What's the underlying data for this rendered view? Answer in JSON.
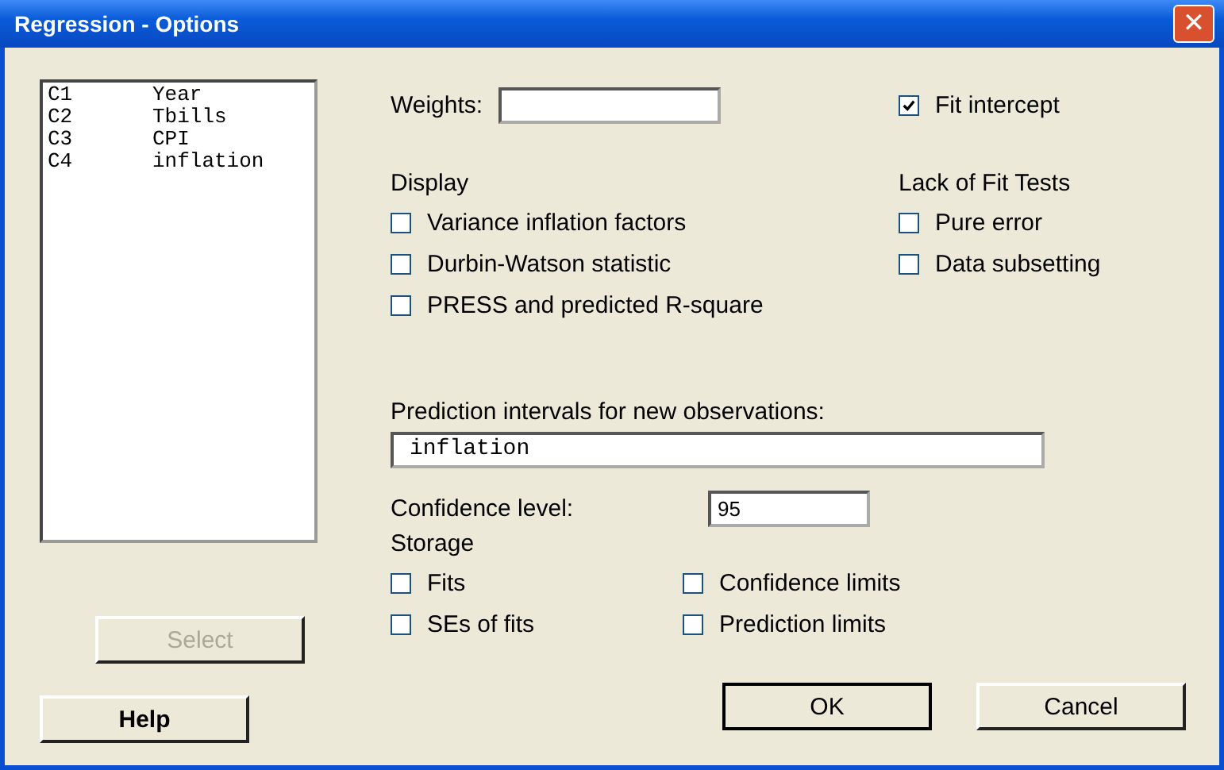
{
  "window": {
    "title": "Regression - Options",
    "close": "✕"
  },
  "columns": [
    {
      "id": "C1",
      "name": "Year"
    },
    {
      "id": "C2",
      "name": "Tbills"
    },
    {
      "id": "C3",
      "name": "CPI"
    },
    {
      "id": "C4",
      "name": "inflation"
    }
  ],
  "select_button": {
    "label": "Select",
    "disabled": true
  },
  "weights": {
    "label": "Weights:"
  },
  "fit_intercept": {
    "label": "Fit intercept",
    "checked": true
  },
  "display": {
    "heading": "Display",
    "options": [
      {
        "label": "Variance inflation factors",
        "checked": false
      },
      {
        "label": "Durbin-Watson statistic",
        "checked": false
      },
      {
        "label": "PRESS and predicted R-square",
        "checked": false
      }
    ]
  },
  "lack_of_fit": {
    "heading": "Lack of Fit Tests",
    "options": [
      {
        "label": "Pure error",
        "checked": false
      },
      {
        "label": "Data subsetting",
        "checked": false
      }
    ]
  },
  "prediction": {
    "label": "Prediction intervals for new observations:",
    "value": "inflation"
  },
  "confidence": {
    "label": "Confidence level:",
    "value": "95"
  },
  "storage": {
    "heading": "Storage",
    "options": [
      {
        "label": "Fits",
        "checked": false
      },
      {
        "label": "Confidence limits",
        "checked": false
      },
      {
        "label": "SEs of fits",
        "checked": false
      },
      {
        "label": "Prediction limits",
        "checked": false
      }
    ]
  },
  "buttons": [
    {
      "label": "Help",
      "kind": "help"
    },
    {
      "label": "OK",
      "kind": "ok"
    },
    {
      "label": "Cancel",
      "kind": "cancel"
    }
  ]
}
